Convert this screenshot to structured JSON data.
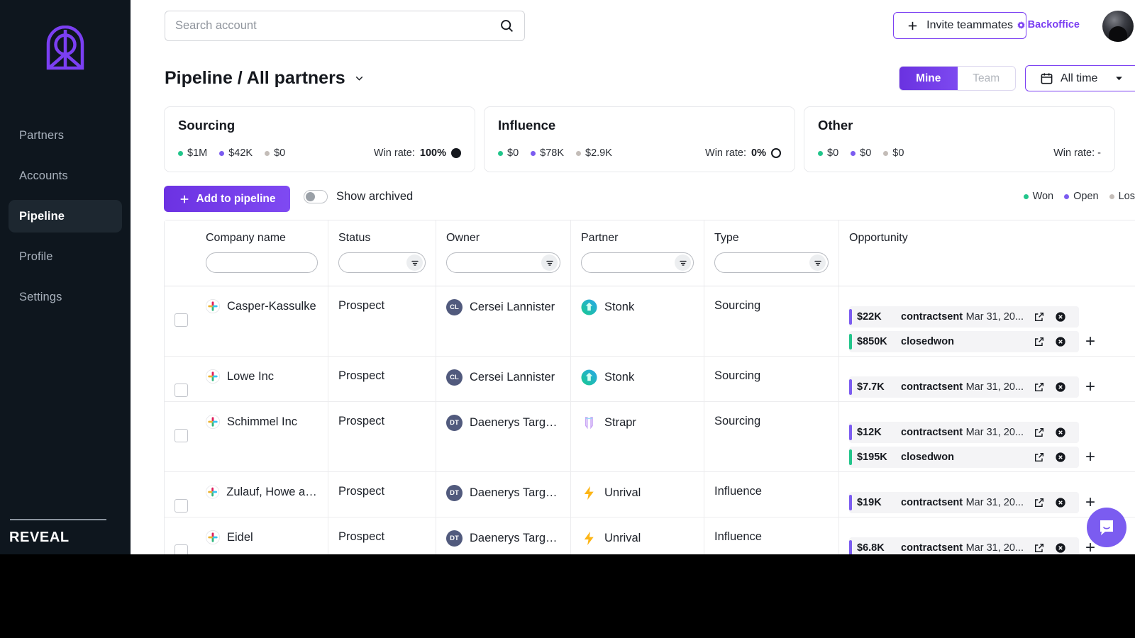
{
  "sidebar": {
    "logo_icon": "reveal-arch-logo",
    "items": [
      {
        "label": "Partners",
        "active": false
      },
      {
        "label": "Accounts",
        "active": false
      },
      {
        "label": "Pipeline",
        "active": true
      },
      {
        "label": "Profile",
        "active": false
      },
      {
        "label": "Settings",
        "active": false
      }
    ],
    "brand": "REVEAL"
  },
  "topbar": {
    "search_placeholder": "Search account",
    "search_value": "",
    "invite_label": "Invite teammates",
    "backoffice_label": "Backoffice"
  },
  "header": {
    "title": "Pipeline / All partners",
    "segments": [
      {
        "label": "Mine",
        "selected": true
      },
      {
        "label": "Team",
        "selected": false
      }
    ],
    "date_filter": "All time"
  },
  "colors": {
    "accent": "#7b3ff2",
    "won": "#22c58b",
    "open": "#7b5cf0",
    "lost": "#c4bdb8"
  },
  "cards": [
    {
      "title": "Sourcing",
      "metrics": [
        {
          "value": "$1M",
          "color": "#22c58b"
        },
        {
          "value": "$42K",
          "color": "#7b5cf0"
        },
        {
          "value": "$0",
          "color": "#c4bdb8"
        }
      ],
      "win_rate_label": "Win rate:",
      "win_rate": "100%",
      "gauge": "full"
    },
    {
      "title": "Influence",
      "metrics": [
        {
          "value": "$0",
          "color": "#22c58b"
        },
        {
          "value": "$78K",
          "color": "#7b5cf0"
        },
        {
          "value": "$2.9K",
          "color": "#c4bdb8"
        }
      ],
      "win_rate_label": "Win rate:",
      "win_rate": "0%",
      "gauge": "empty"
    },
    {
      "title": "Other",
      "metrics": [
        {
          "value": "$0",
          "color": "#22c58b"
        },
        {
          "value": "$0",
          "color": "#7b5cf0"
        },
        {
          "value": "$0",
          "color": "#c4bdb8"
        }
      ],
      "win_rate_label": "Win rate: -",
      "win_rate": "",
      "gauge": "none"
    }
  ],
  "toolbar": {
    "add_label": "Add to pipeline",
    "archived_label": "Show archived",
    "archived_on": false,
    "legend": [
      {
        "label": "Won",
        "color": "#22c58b"
      },
      {
        "label": "Open",
        "color": "#7b5cf0"
      },
      {
        "label": "Los",
        "color": "#c4bdb8"
      }
    ]
  },
  "table": {
    "columns": [
      {
        "label": "Company name",
        "filter": false
      },
      {
        "label": "Status",
        "filter": true
      },
      {
        "label": "Owner",
        "filter": true
      },
      {
        "label": "Partner",
        "filter": true
      },
      {
        "label": "Type",
        "filter": true
      },
      {
        "label": "Opportunity",
        "filter": false
      }
    ],
    "rows": [
      {
        "company": "Casper-Kassulke",
        "company_icon": "slack-logo-icon",
        "status": "Prospect",
        "owner": "Cersei Lannister",
        "owner_initials": "CL",
        "partner": "Stonk",
        "partner_icon": "stonk-logo-icon",
        "type": "Sourcing",
        "opportunities": [
          {
            "amount": "$22K",
            "stage": "contractsent",
            "date": "Mar 31, 20...",
            "color": "#7b5cf0"
          },
          {
            "amount": "$850K",
            "stage": "closedwon",
            "date": "",
            "color": "#22c58b"
          }
        ]
      },
      {
        "company": "Lowe Inc",
        "company_icon": "slack-logo-icon",
        "status": "Prospect",
        "owner": "Cersei Lannister",
        "owner_initials": "CL",
        "partner": "Stonk",
        "partner_icon": "stonk-logo-icon",
        "type": "Sourcing",
        "opportunities": [
          {
            "amount": "$7.7K",
            "stage": "contractsent",
            "date": "Mar 31, 20...",
            "color": "#7b5cf0"
          }
        ]
      },
      {
        "company": "Schimmel Inc",
        "company_icon": "slack-logo-icon",
        "status": "Prospect",
        "owner": "Daenerys Targer...",
        "owner_initials": "DT",
        "partner": "Strapr",
        "partner_icon": "strapr-logo-icon",
        "type": "Sourcing",
        "opportunities": [
          {
            "amount": "$12K",
            "stage": "contractsent",
            "date": "Mar 31, 20...",
            "color": "#7b5cf0"
          },
          {
            "amount": "$195K",
            "stage": "closedwon",
            "date": "",
            "color": "#22c58b"
          }
        ]
      },
      {
        "company": "Zulauf, Howe an...",
        "company_icon": "slack-logo-icon",
        "status": "Prospect",
        "owner": "Daenerys Targer...",
        "owner_initials": "DT",
        "partner": "Unrival",
        "partner_icon": "unrival-bolt-icon",
        "type": "Influence",
        "opportunities": [
          {
            "amount": "$19K",
            "stage": "contractsent",
            "date": "Mar 31, 20...",
            "color": "#7b5cf0"
          }
        ]
      },
      {
        "company": "Eidel",
        "company_icon": "slack-logo-icon",
        "status": "Prospect",
        "owner": "Daenerys Targer...",
        "owner_initials": "DT",
        "partner": "Unrival",
        "partner_icon": "unrival-bolt-icon",
        "type": "Influence",
        "opportunities": [
          {
            "amount": "$6.8K",
            "stage": "contractsent",
            "date": "Mar 31, 20...",
            "color": "#7b5cf0"
          }
        ]
      }
    ]
  }
}
